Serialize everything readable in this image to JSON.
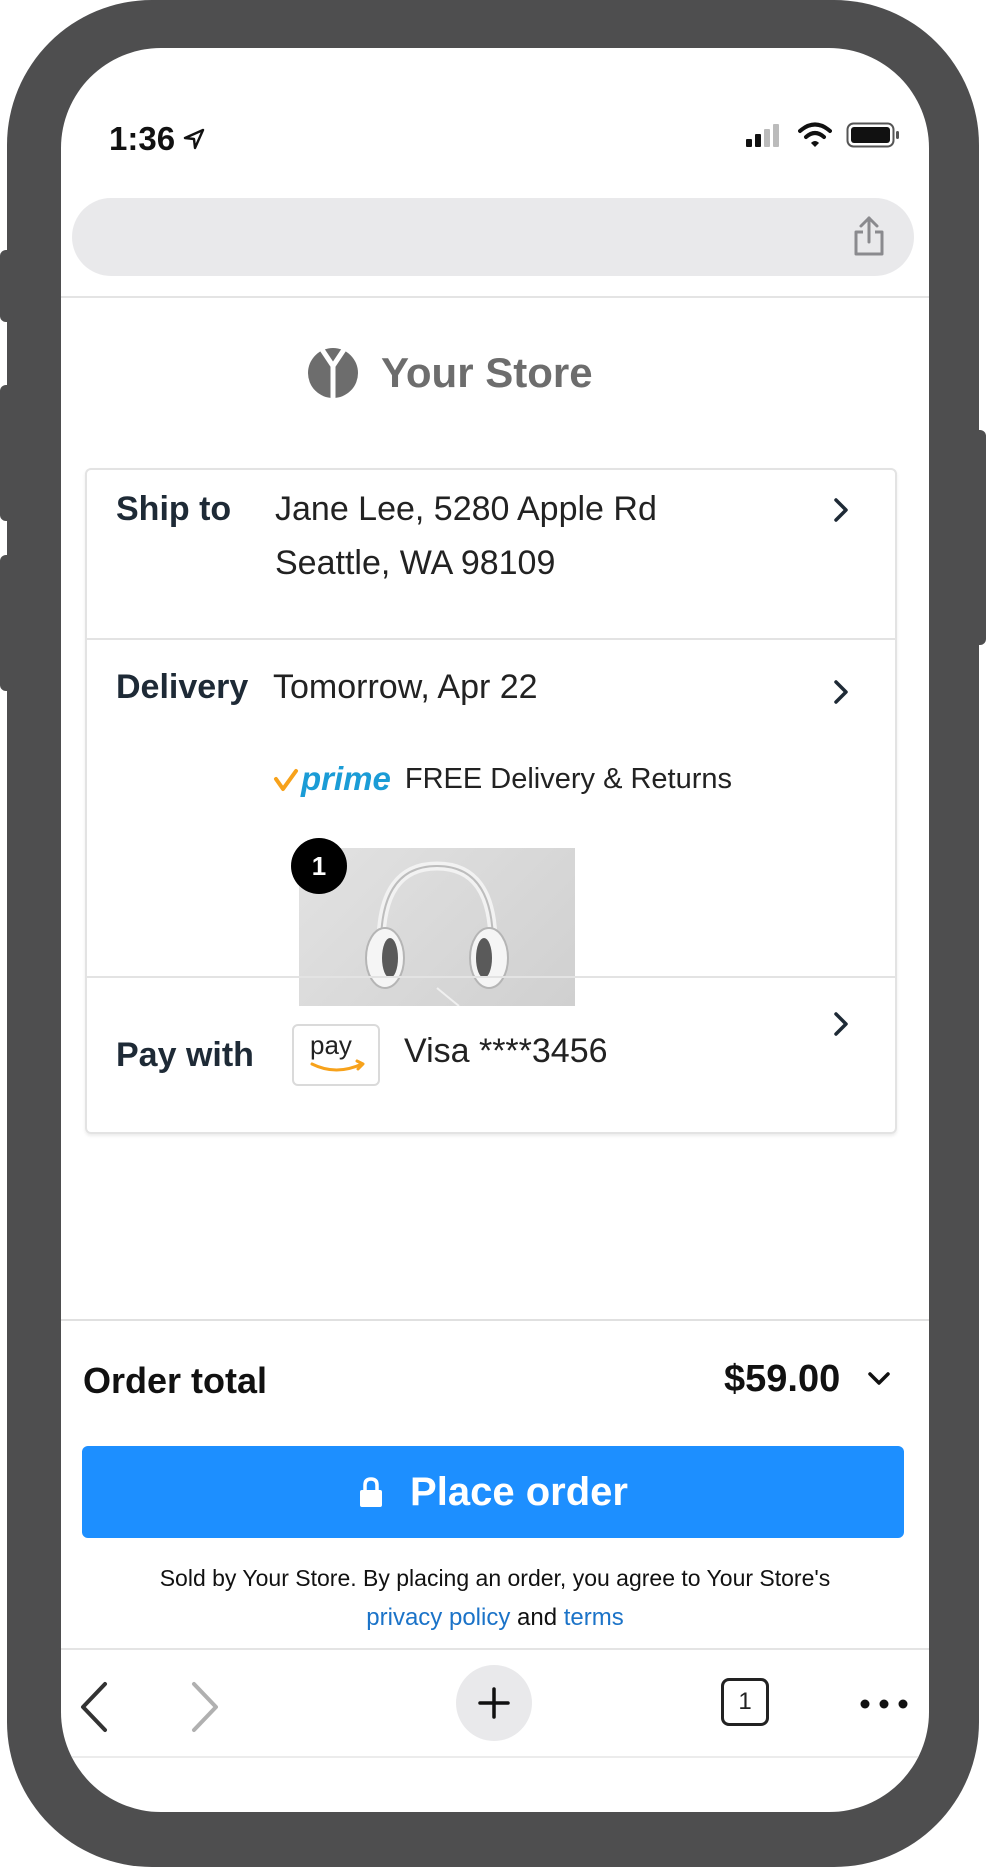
{
  "status_bar": {
    "time": "1:36",
    "icons": [
      "location-arrow-icon",
      "cellular-signal-icon",
      "wifi-icon",
      "battery-icon"
    ]
  },
  "browser": {
    "url": "",
    "share_icon": "share-icon",
    "toolbar": {
      "icons": [
        "back-arrow-icon",
        "forward-arrow-icon",
        "plus-icon",
        "tabs-icon",
        "more-dots-icon"
      ],
      "tab_count": "1"
    }
  },
  "store": {
    "name": "Your Store",
    "logo_icon": "store-logo-icon"
  },
  "checkout": {
    "ship_to": {
      "label": "Ship to",
      "line1": "Jane Lee, 5280 Apple Rd",
      "line2": "Seattle, WA 98109"
    },
    "delivery": {
      "label": "Delivery",
      "date": "Tomorrow, Apr 22",
      "prime_text": "prime",
      "prime_note": "FREE Delivery & Returns",
      "item_quantity": "1",
      "item_image": "headphones-image"
    },
    "payment": {
      "label": "Pay with",
      "pay_logo_text": "pay",
      "method": "Visa ****3456"
    }
  },
  "order": {
    "total_label": "Order total",
    "total_amount": "$59.00",
    "place_order_label": "Place order",
    "legal_text": "Sold by Your Store. By placing an order, you agree to Your Store's",
    "privacy_link": "privacy policy",
    "and_text": "and",
    "terms_link": "terms"
  },
  "colors": {
    "primary_button": "#1d8fff",
    "prime_blue": "#1b9cd6",
    "prime_check": "#f7a21b",
    "link": "#1b73c8",
    "device_frame": "#4e4e4f"
  }
}
